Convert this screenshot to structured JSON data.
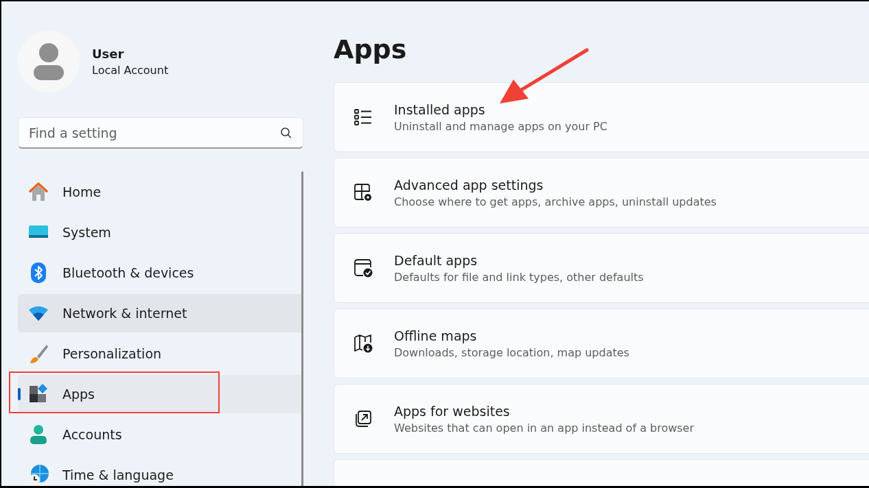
{
  "sidebar": {
    "user": {
      "name": "User",
      "account": "Local Account"
    },
    "search": {
      "placeholder": "Find a setting"
    },
    "items": [
      {
        "label": "Home",
        "selected": false,
        "hovered": false,
        "annotated": false
      },
      {
        "label": "System",
        "selected": false,
        "hovered": false,
        "annotated": false
      },
      {
        "label": "Bluetooth & devices",
        "selected": false,
        "hovered": false,
        "annotated": false
      },
      {
        "label": "Network & internet",
        "selected": false,
        "hovered": true,
        "annotated": false
      },
      {
        "label": "Personalization",
        "selected": false,
        "hovered": false,
        "annotated": false
      },
      {
        "label": "Apps",
        "selected": true,
        "hovered": false,
        "annotated": true
      },
      {
        "label": "Accounts",
        "selected": false,
        "hovered": false,
        "annotated": false
      },
      {
        "label": "Time & language",
        "selected": false,
        "hovered": false,
        "annotated": false
      }
    ]
  },
  "page": {
    "title": "Apps",
    "cards": [
      {
        "kind": "entry",
        "title": "Installed apps",
        "description": "Uninstall and manage apps on your PC",
        "annotated": true
      },
      {
        "kind": "entry",
        "title": "Advanced app settings",
        "description": "Choose where to get apps, archive apps, uninstall updates",
        "annotated": false
      },
      {
        "kind": "entry",
        "title": "Default apps",
        "description": "Defaults for file and link types, other defaults",
        "annotated": false
      },
      {
        "kind": "entry",
        "title": "Offline maps",
        "description": "Downloads, storage location, map updates",
        "annotated": false
      },
      {
        "kind": "entry",
        "title": "Apps for websites",
        "description": "Websites that can open in an app instead of a browser",
        "annotated": false
      },
      {
        "kind": "partial",
        "annotated": false
      }
    ]
  }
}
